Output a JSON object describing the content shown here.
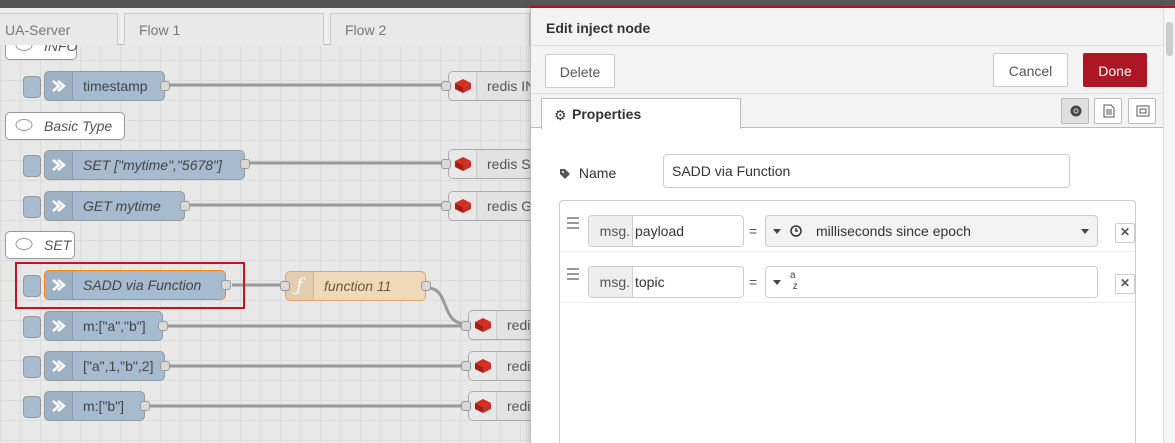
{
  "workspace": {
    "tabs": [
      {
        "label": "UA-Server"
      },
      {
        "label": "Flow 1"
      },
      {
        "label": "Flow 2"
      }
    ],
    "comments": {
      "info": "INFO",
      "basic_type": "Basic Type",
      "set": "SET"
    },
    "inject_nodes": {
      "timestamp": "timestamp",
      "set_mytime": "SET [\"mytime\",\"5678\"]",
      "get_mytime": "GET mytime",
      "sadd_via_function": "SADD via Function",
      "m_a_b": "m:[\"a\",\"b\"]",
      "a1b2": "[\"a\",1,\"b\",2]",
      "m_b": "m:[\"b\"]"
    },
    "function_node": "function 11",
    "redis_nodes": {
      "info": "redis IN",
      "set": "redis SE",
      "get": "redis GE",
      "r1": "redis",
      "r2": "redis",
      "r3": "redis"
    }
  },
  "panel": {
    "title": "Edit inject node",
    "buttons": {
      "delete": "Delete",
      "cancel": "Cancel",
      "done": "Done"
    },
    "tab": "Properties",
    "name_label": "Name",
    "name_value": "SADD via Function",
    "props": [
      {
        "prefix": "msg.",
        "key": "payload",
        "type_icon": "clock-icon",
        "value": "milliseconds since epoch"
      },
      {
        "prefix": "msg.",
        "key": "topic",
        "type_icon": "string-az-icon",
        "value": ""
      }
    ]
  },
  "colors": {
    "accent": "#ad1625",
    "inject_node": "#a6bbcf",
    "function_node": "#f0d9b8",
    "highlight": "#c4141f"
  }
}
